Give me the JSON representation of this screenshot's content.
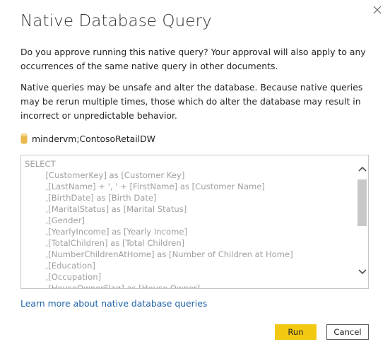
{
  "dialog": {
    "title": "Native Database Query",
    "approval_text": "Do you approve running this native query? Your approval will also apply to any occurrences of the same native query in other documents.",
    "warning_text": "Native queries may be unsafe and alter the database. Because native queries may be rerun multiple times, those which do alter the database may result in incorrect or unpredictable behavior.",
    "source": "mindervm;ContosoRetailDW",
    "query_lines": [
      "SELECT",
      "        [CustomerKey] as [Customer Key]",
      "        ,[LastName] + ', ' + [FirstName] as [Customer Name]",
      "        ,[BirthDate] as [Birth Date]",
      "        ,[MaritalStatus] as [Marital Status]",
      "        ,[Gender]",
      "        ,[YearlyIncome] as [Yearly Income]",
      "        ,[TotalChildren] as [Total Children]",
      "        ,[NumberChildrenAtHome] as [Number of Children at Home]",
      "        ,[Education]",
      "        ,[Occupation]",
      "        ,[HouseOwnerFlag] as [House Owner]"
    ],
    "learn_more": "Learn more about native database queries",
    "run_label": "Run",
    "cancel_label": "Cancel"
  },
  "colors": {
    "accent": "#f2c811",
    "link": "#1f63a8",
    "db_icon": "#e8b84a"
  },
  "icons": {
    "close": "close-icon",
    "database": "database-icon",
    "scroll_up": "chevron-up-icon",
    "scroll_down": "chevron-down-icon"
  }
}
